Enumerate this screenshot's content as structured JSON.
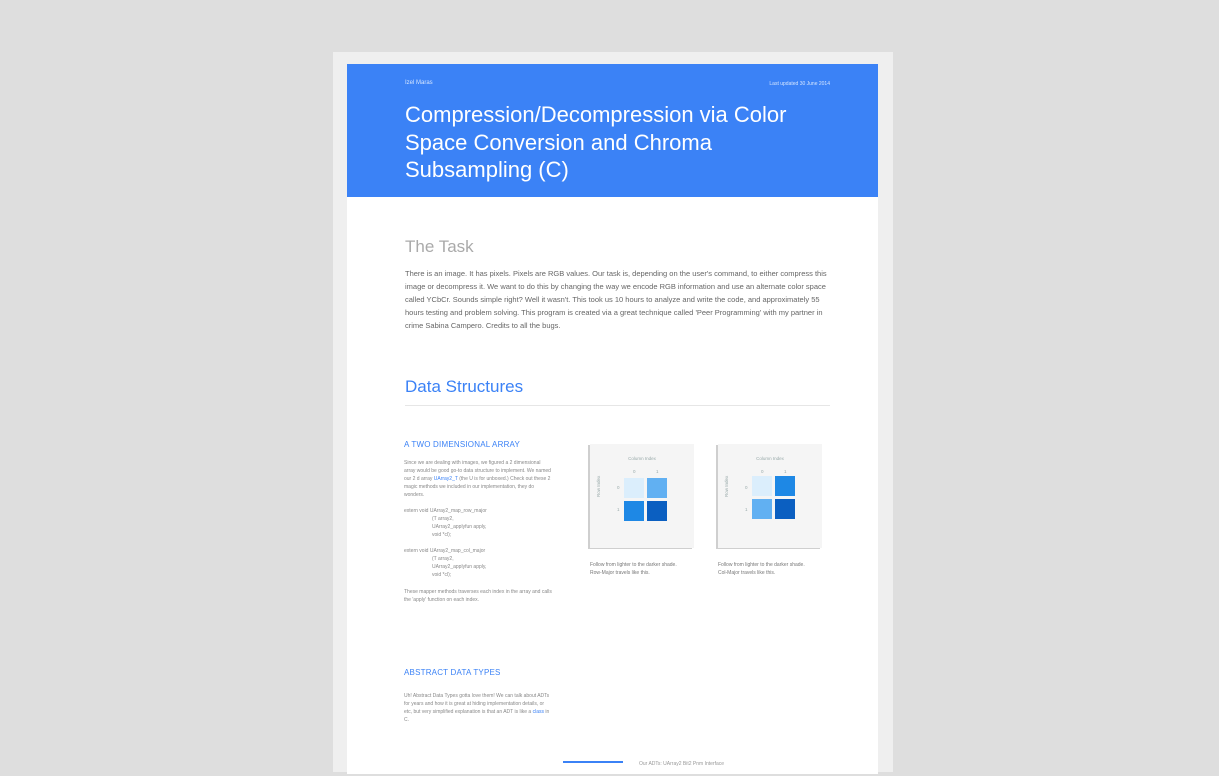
{
  "header": {
    "author": "Izel Maras",
    "updated": "Last updated 30 June 2014",
    "title": "Compression/Decompression via Color Space Conversion and Chroma Subsampling (C)"
  },
  "task": {
    "heading": "The Task",
    "body": "There is an image. It has pixels. Pixels are RGB values. Our task is, depending on the user's command, to either compress this image or decompress it. We want to do this by changing the way we encode RGB information and use an alternate color space called YCbCr. Sounds simple right? Well it wasn't. This took us 10 hours to analyze and write the code, and approximately 55 hours testing and problem solving. This program is created via a great technique called 'Peer Programming' with my partner in crime Sabina Campero. Credits to all the bugs."
  },
  "data_structures": {
    "heading": "Data Structures",
    "two_d": {
      "heading": "A TWO DIMENSIONAL ARRAY",
      "intro_a": "Since we are dealing with images, we figured a 2 dimensional array would be good go-to data structure to implement. We named our 2 d array ",
      "intro_link": "UArray2_T",
      "intro_b": " (the U is for unboxed.) Check out these 2 magic methods we included in our implementation, they do wonders.",
      "code1": [
        "extern void  UArray2_map_row_major",
        "(T array2,",
        "UArray2_applyfun apply,",
        "void *cl);"
      ],
      "code2": [
        "extern void  UArray2_map_col_major",
        "(T array2,",
        "UArray2_applyfun apply,",
        "void *cl);"
      ],
      "outro": "These mapper methods traverses each index in the array and calls the 'apply' function on each index."
    },
    "figures": [
      {
        "column_label": "Column Index",
        "row_label": "Row Index",
        "col_indices": [
          "0",
          "1"
        ],
        "row_indices": [
          "0",
          "1"
        ],
        "cell_colors": [
          "#dbeefc",
          "#61b0f2",
          "#1e88e5",
          "#0b5fc1"
        ],
        "caption_line1": "Follow from lighter to the darker shade.",
        "caption_line2": "Row-Major travels like this."
      },
      {
        "column_label": "Column Index",
        "row_label": "Row Index",
        "col_indices": [
          "0",
          "1"
        ],
        "row_indices": [
          "0",
          "1"
        ],
        "cell_colors": [
          "#dbeefc",
          "#1e88e5",
          "#61b0f2",
          "#0b5fc1"
        ],
        "caption_line1": "Follow from lighter to the darker shade.",
        "caption_line2": "Col-Major travels like this."
      }
    ],
    "adt": {
      "heading": "ABSTRACT DATA TYPES",
      "body_a": "Uh! Abstract Data Types gotta love them! We can talk about ADTs for years and how it is great at hiding implementation details, or etc, but very simplified explanation is that an ADT is like a ",
      "body_link": "class",
      "body_b": " in C."
    }
  },
  "footer_peek": {
    "text": "Our ADTs: UArray2 Bit2 Pnm Interface"
  }
}
